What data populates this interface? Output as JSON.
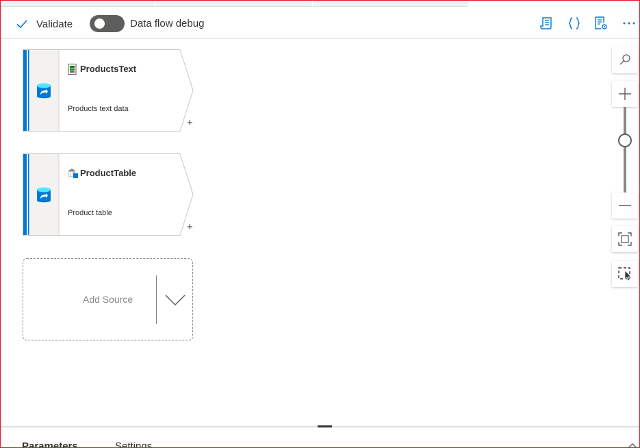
{
  "toolbar": {
    "validate_label": "Validate",
    "debug_label": "Data flow debug",
    "debug_on": false,
    "icons": [
      "script-icon",
      "code-braces-icon",
      "properties-icon",
      "more-icon"
    ]
  },
  "nodes": [
    {
      "title": "ProductsText",
      "description": "Products text data",
      "type_icon": "csv-file-icon",
      "source_icon": "source-database-icon"
    },
    {
      "title": "ProductTable",
      "description": "Product table",
      "type_icon": "sql-table-icon",
      "source_icon": "source-database-icon"
    }
  ],
  "add_source": {
    "label": "Add Source"
  },
  "zoom_controls": {
    "icons": [
      "search-icon",
      "zoom-in-icon",
      "zoom-out-icon",
      "fit-to-screen-icon",
      "select-mode-icon"
    ]
  },
  "bottom_panel": {
    "tabs": [
      "Parameters",
      "Settings"
    ]
  },
  "colors": {
    "accent": "#0078d4",
    "node_bar": "#0078d4",
    "text": "#323130",
    "muted": "#8a8886"
  }
}
